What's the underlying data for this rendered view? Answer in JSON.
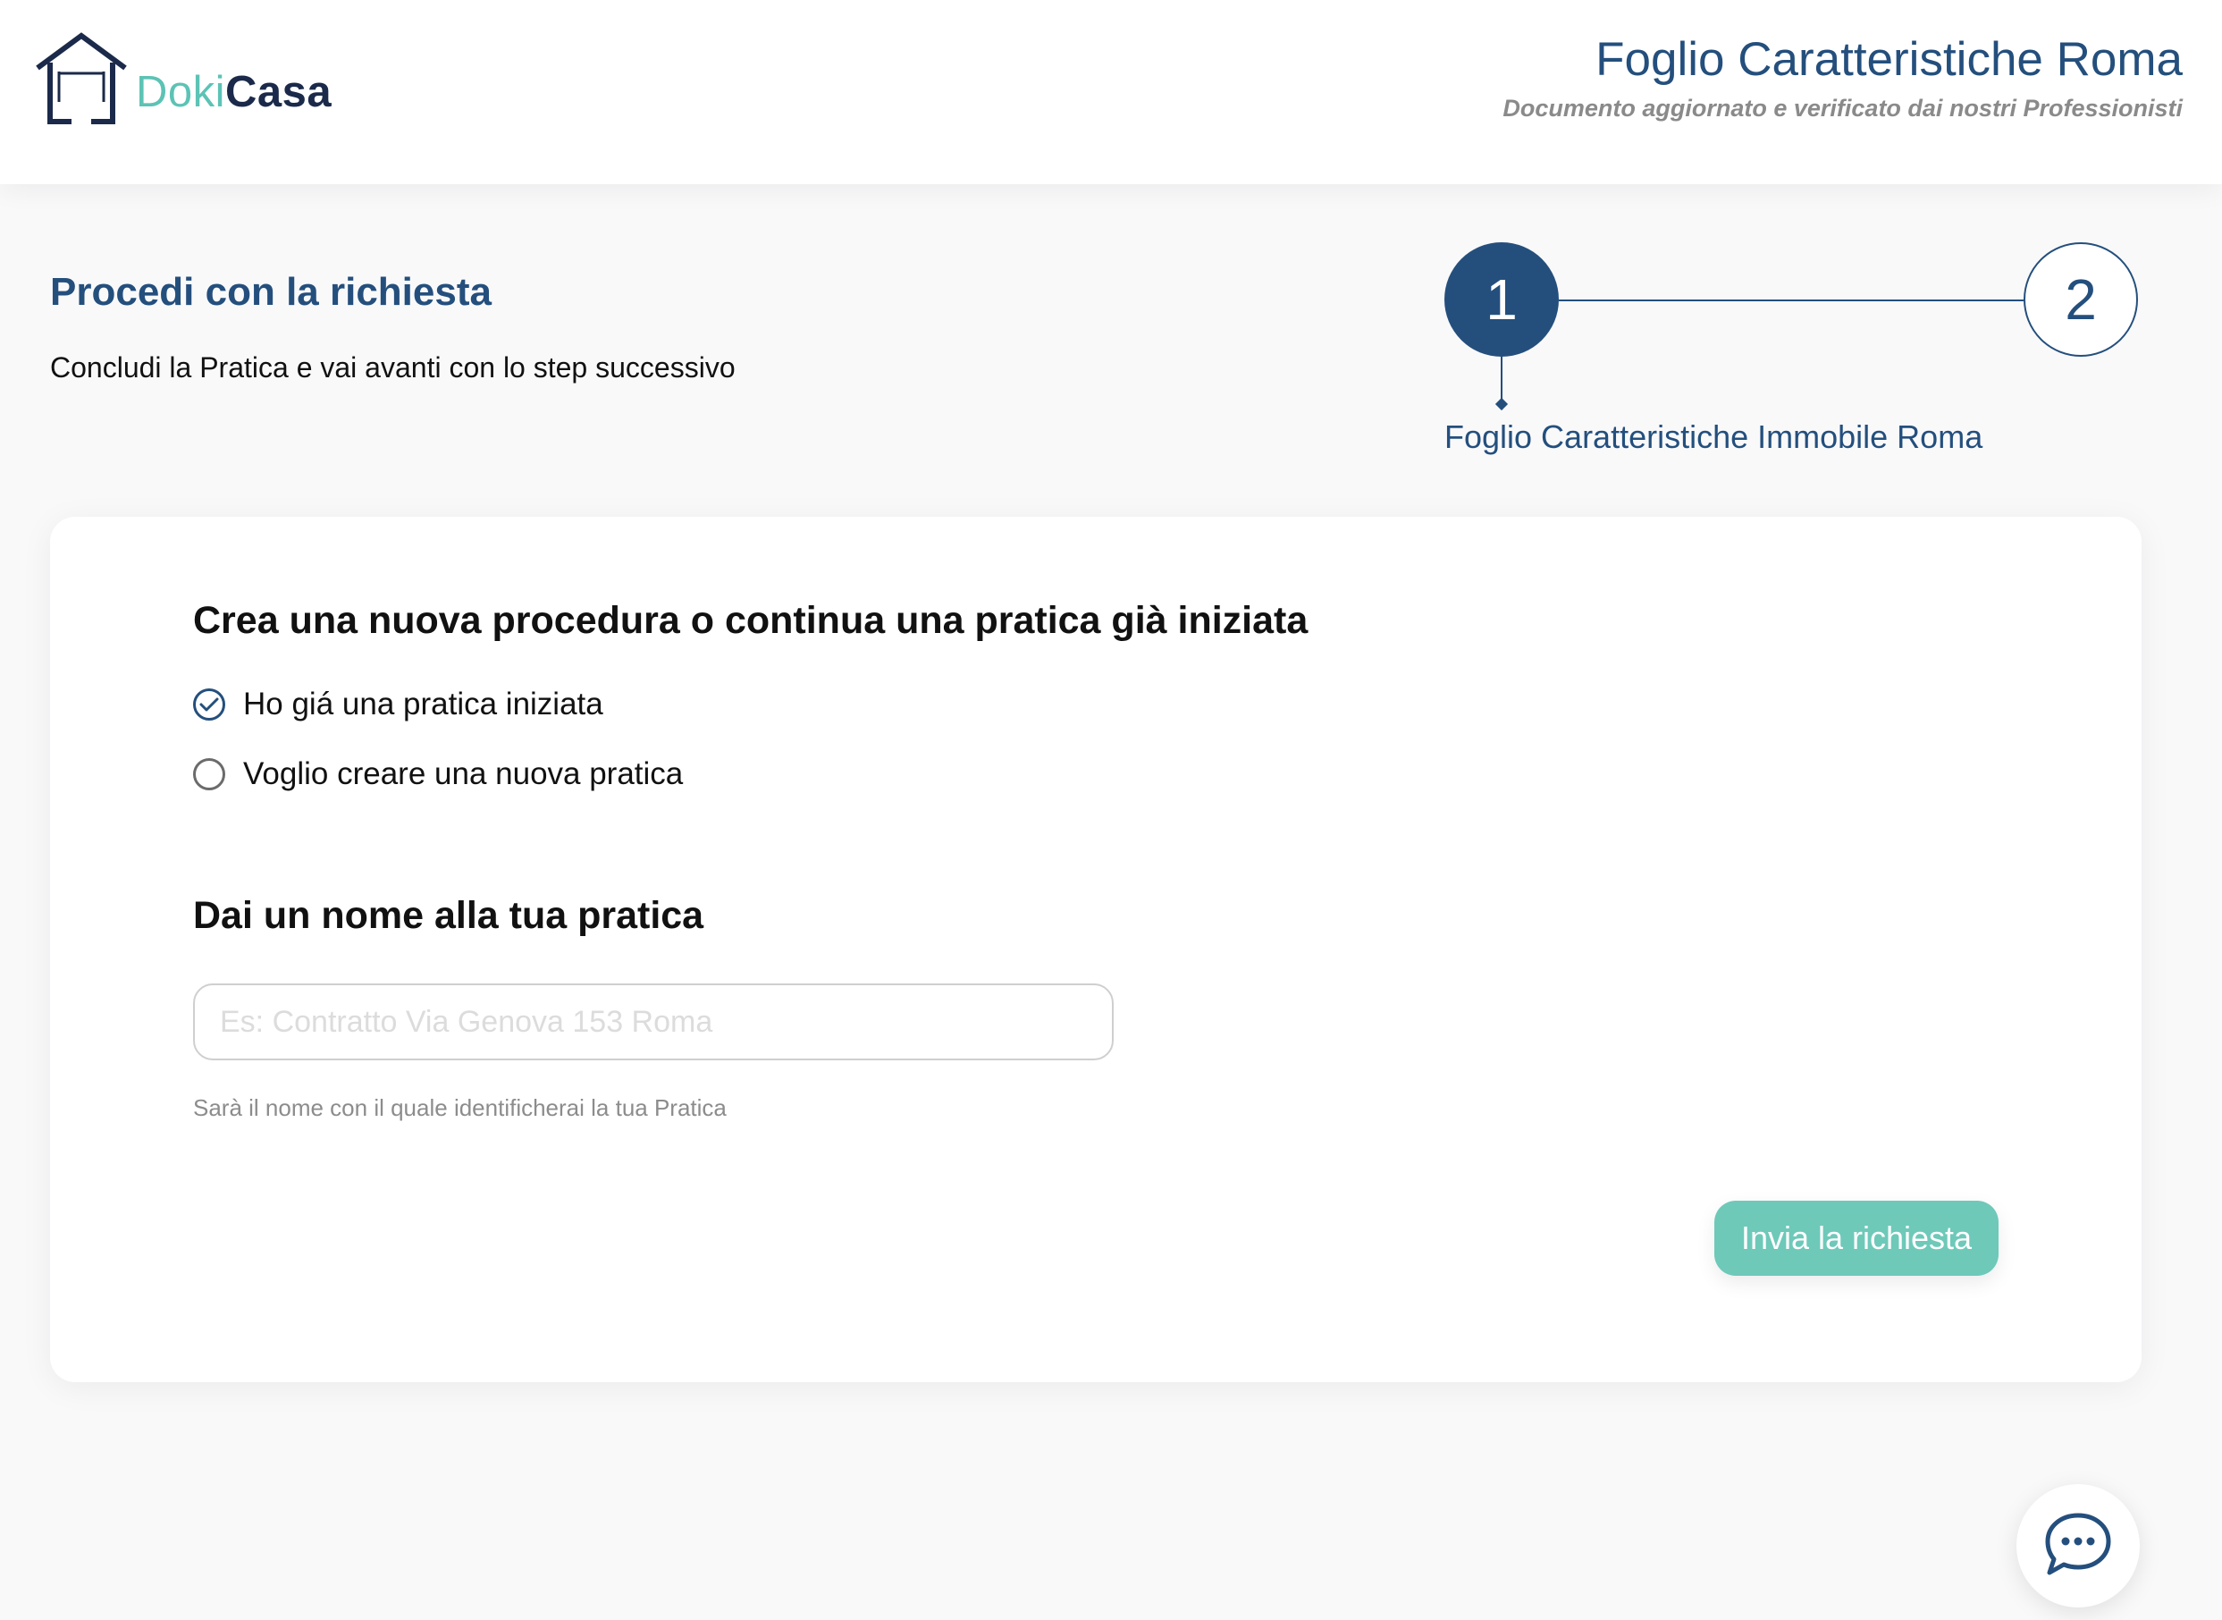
{
  "header": {
    "logo": {
      "part1": "Doki",
      "part2": "Casa"
    },
    "title": "Foglio Caratteristiche Roma",
    "subtitle": "Documento aggiornato e verificato dai nostri Professionisti"
  },
  "intro": {
    "title": "Procedi con la richiesta",
    "description": "Concludi la Pratica e vai avanti con lo step successivo"
  },
  "stepper": {
    "steps": [
      {
        "number": "1",
        "active": true,
        "label": "Foglio Caratteristiche Immobile Roma"
      },
      {
        "number": "2",
        "active": false
      }
    ]
  },
  "form": {
    "procedure_heading": "Crea una nuova procedura o continua una pratica già iniziata",
    "options": [
      {
        "label": "Ho giá una pratica iniziata",
        "selected": true
      },
      {
        "label": "Voglio creare una nuova pratica",
        "selected": false
      }
    ],
    "name_heading": "Dai un nome alla tua pratica",
    "name_input": {
      "value": "",
      "placeholder": "Es: Contratto Via Genova 153 Roma"
    },
    "name_hint": "Sarà il nome con il quale identificherai la tua Pratica",
    "submit_label": "Invia la richiesta"
  },
  "icons": {
    "logo": "house-logo-icon",
    "check": "check-icon",
    "chat": "chat-bubble-icon"
  },
  "colors": {
    "primary": "#244f7d",
    "accent": "#6ec9b9",
    "logo_teal": "#5cc3b5",
    "logo_navy": "#1b2a4a",
    "background": "#f9f9fa"
  }
}
